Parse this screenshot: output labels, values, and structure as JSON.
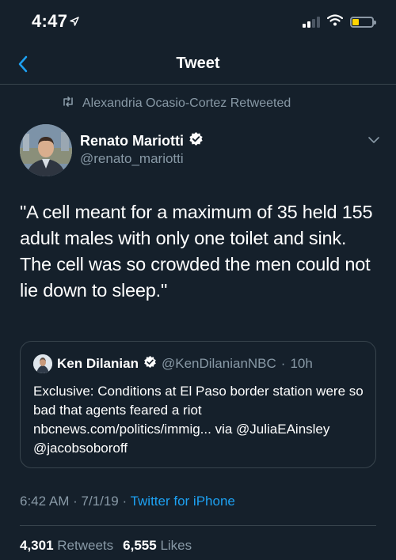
{
  "status_bar": {
    "time": "4:47",
    "signal_bars": 4,
    "signal_bars_active": 2,
    "battery_level": 0.35
  },
  "nav": {
    "back_icon": "chevron-left-icon",
    "title": "Tweet"
  },
  "retweet_context": {
    "icon": "retweet-icon",
    "text": "Alexandria Ocasio-Cortez Retweeted"
  },
  "tweet": {
    "author_name": "Renato Mariotti",
    "author_handle": "@renato_mariotti",
    "verified": true,
    "text": "\"A cell meant for a maximum of 35 held 155 adult males with only one toilet and sink. The cell was so crowded the men could not lie down to sleep.\"",
    "time": "6:42 AM",
    "date": "7/1/19",
    "source": "Twitter for iPhone",
    "retweets_count": "4,301",
    "retweets_label": "Retweets",
    "likes_count": "6,555",
    "likes_label": "Likes"
  },
  "quoted_tweet": {
    "author_name": "Ken Dilanian",
    "author_handle": "@KenDilanianNBC",
    "separator": "·",
    "time": "10h",
    "verified": true,
    "text": "Exclusive: Conditions at El Paso border station were so bad that agents feared a riot nbcnews.com/politics/immig... via @JuliaEAinsley @jacobsoboroff"
  },
  "colors": {
    "background": "#15202b",
    "secondary_text": "#8899a6",
    "accent": "#1da1f2",
    "border": "#38444d"
  }
}
